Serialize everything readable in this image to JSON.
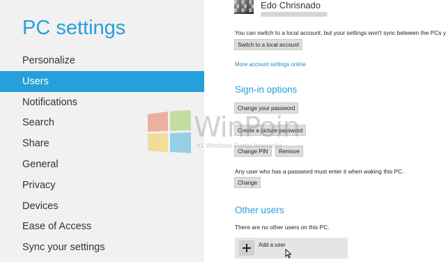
{
  "sidebar": {
    "title": "PC settings",
    "items": [
      {
        "label": "Personalize"
      },
      {
        "label": "Users",
        "selected": true
      },
      {
        "label": "Notifications"
      },
      {
        "label": "Search"
      },
      {
        "label": "Share"
      },
      {
        "label": "General"
      },
      {
        "label": "Privacy"
      },
      {
        "label": "Devices"
      },
      {
        "label": "Ease of Access"
      },
      {
        "label": "Sync your settings"
      }
    ]
  },
  "account": {
    "name": "Edo Chrisnado",
    "local_account_notice": "You can switch to a local account, but your settings won't sync between the PCs you us",
    "switch_button": "Switch to a local account",
    "more_settings_link": "More account settings online"
  },
  "signin": {
    "heading": "Sign-in options",
    "change_password_button": "Change your password",
    "picture_password_button": "Create a picture password",
    "change_pin_button": "Change PIN",
    "remove_button": "Remove",
    "password_notice": "Any user who has a password must enter it when waking this PC.",
    "change_button": "Change"
  },
  "other_users": {
    "heading": "Other users",
    "notice": "There are no other users on this PC.",
    "add_user_label": "Add a user"
  },
  "watermark": {
    "title": "WinPoin",
    "subtitle": "#1 Windows Portal Indonesia"
  },
  "colors": {
    "accent": "#26a0da",
    "link": "#1b8bc4",
    "sidebar_bg": "#f1f1f1"
  }
}
